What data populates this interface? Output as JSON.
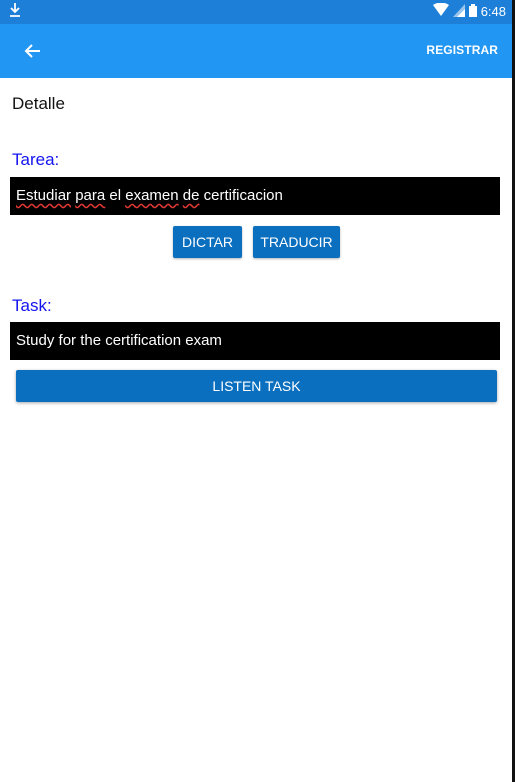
{
  "status_bar": {
    "time": "6:48",
    "download_icon": "download-icon",
    "wifi_icon": "wifi-icon",
    "signal_icon": "signal-icon",
    "battery_icon": "battery-icon"
  },
  "app_bar": {
    "back_icon": "arrow-back-icon",
    "action_label": "REGISTRAR"
  },
  "page": {
    "title": "Detalle"
  },
  "tarea": {
    "label": "Tarea:",
    "value_parts": [
      "Estudiar",
      " ",
      "para",
      " el ",
      "examen",
      " ",
      "de",
      " certificacion"
    ],
    "buttons": {
      "dictar": "DICTAR",
      "traducir": "TRADUCIR"
    }
  },
  "task": {
    "label": "Task:",
    "value": "Study for the certification exam",
    "listen_label": "LISTEN TASK"
  },
  "colors": {
    "status_bar": "#1e7fd8",
    "app_bar": "#2196f3",
    "button": "#0b6fbf",
    "label": "#1414f0"
  }
}
